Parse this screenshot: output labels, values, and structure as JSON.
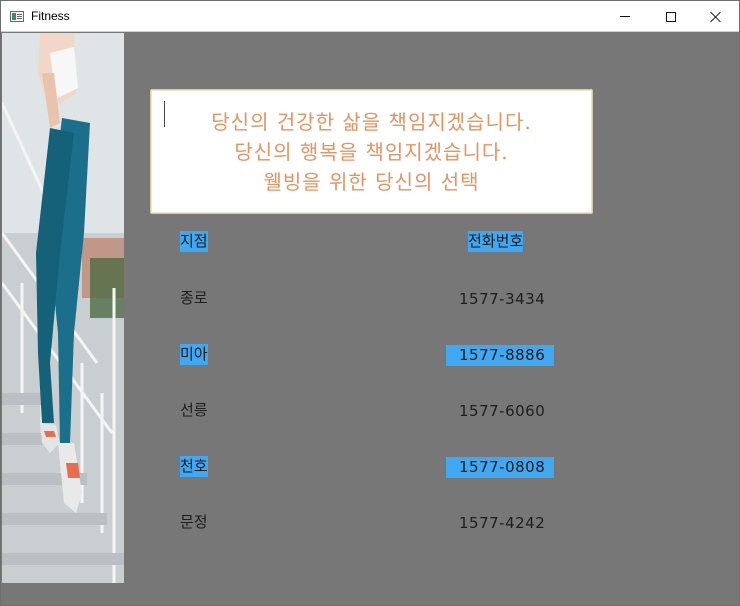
{
  "window": {
    "title": "Fitness",
    "controls": {
      "minimize": "minimize",
      "maximize": "maximize",
      "close": "close"
    }
  },
  "colors": {
    "content_bg": "#777777",
    "slogan_text": "#e8925f",
    "selection": "#3fa8f0"
  },
  "slogan": {
    "lines": [
      "당신의 건강한 삶을 책임지겠습니다.",
      "당신의 행복을 책임지겠습니다.",
      "웰빙을 위한 당신의 선택"
    ]
  },
  "table": {
    "headers": {
      "branch": "지점",
      "phone": "전화번호"
    },
    "rows": [
      {
        "branch": "종로",
        "phone": "1577-3434",
        "highlighted": false
      },
      {
        "branch": "미아",
        "phone": "1577-8886",
        "highlighted": true
      },
      {
        "branch": "선릉",
        "phone": "1577-6060",
        "highlighted": false
      },
      {
        "branch": "천호",
        "phone": "1577-0808",
        "highlighted": true
      },
      {
        "branch": "문정",
        "phone": "1577-4242",
        "highlighted": false
      }
    ]
  },
  "image": {
    "subject": "runner-legs-photo"
  }
}
